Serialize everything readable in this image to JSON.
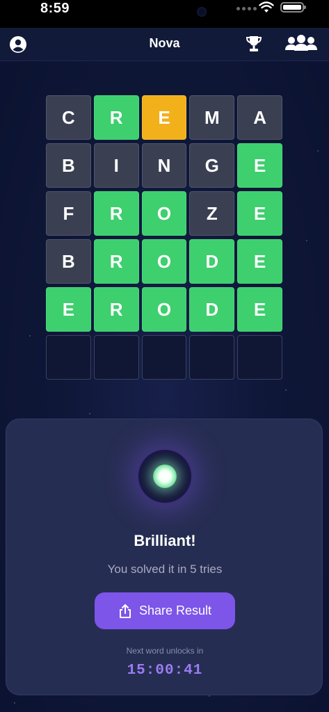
{
  "status": {
    "time": "8:59"
  },
  "header": {
    "title": "Nova"
  },
  "board": {
    "rows": [
      [
        {
          "l": "C",
          "s": "gray"
        },
        {
          "l": "R",
          "s": "green"
        },
        {
          "l": "E",
          "s": "yellow"
        },
        {
          "l": "M",
          "s": "gray"
        },
        {
          "l": "A",
          "s": "gray"
        }
      ],
      [
        {
          "l": "B",
          "s": "gray"
        },
        {
          "l": "I",
          "s": "gray"
        },
        {
          "l": "N",
          "s": "gray"
        },
        {
          "l": "G",
          "s": "gray"
        },
        {
          "l": "E",
          "s": "green"
        }
      ],
      [
        {
          "l": "F",
          "s": "gray"
        },
        {
          "l": "R",
          "s": "green"
        },
        {
          "l": "O",
          "s": "green"
        },
        {
          "l": "Z",
          "s": "gray"
        },
        {
          "l": "E",
          "s": "green"
        }
      ],
      [
        {
          "l": "B",
          "s": "gray"
        },
        {
          "l": "R",
          "s": "green"
        },
        {
          "l": "O",
          "s": "green"
        },
        {
          "l": "D",
          "s": "green"
        },
        {
          "l": "E",
          "s": "green"
        }
      ],
      [
        {
          "l": "E",
          "s": "green"
        },
        {
          "l": "R",
          "s": "green"
        },
        {
          "l": "O",
          "s": "green"
        },
        {
          "l": "D",
          "s": "green"
        },
        {
          "l": "E",
          "s": "green"
        }
      ],
      [
        {
          "l": "",
          "s": "empty"
        },
        {
          "l": "",
          "s": "empty"
        },
        {
          "l": "",
          "s": "empty"
        },
        {
          "l": "",
          "s": "empty"
        },
        {
          "l": "",
          "s": "empty"
        }
      ]
    ]
  },
  "result": {
    "title": "Brilliant!",
    "subtitle": "You solved it in 5 tries",
    "share_label": "Share Result",
    "next_label": "Next word unlocks in",
    "countdown": "15:00:41"
  },
  "icons": {
    "profile": "person-circle-icon",
    "trophy": "trophy-icon",
    "friends": "group-icon",
    "share": "share-icon"
  },
  "colors": {
    "green": "#3ecf6e",
    "yellow": "#f2b01a",
    "gray": "#3a4052",
    "accent": "#7d55e8"
  }
}
